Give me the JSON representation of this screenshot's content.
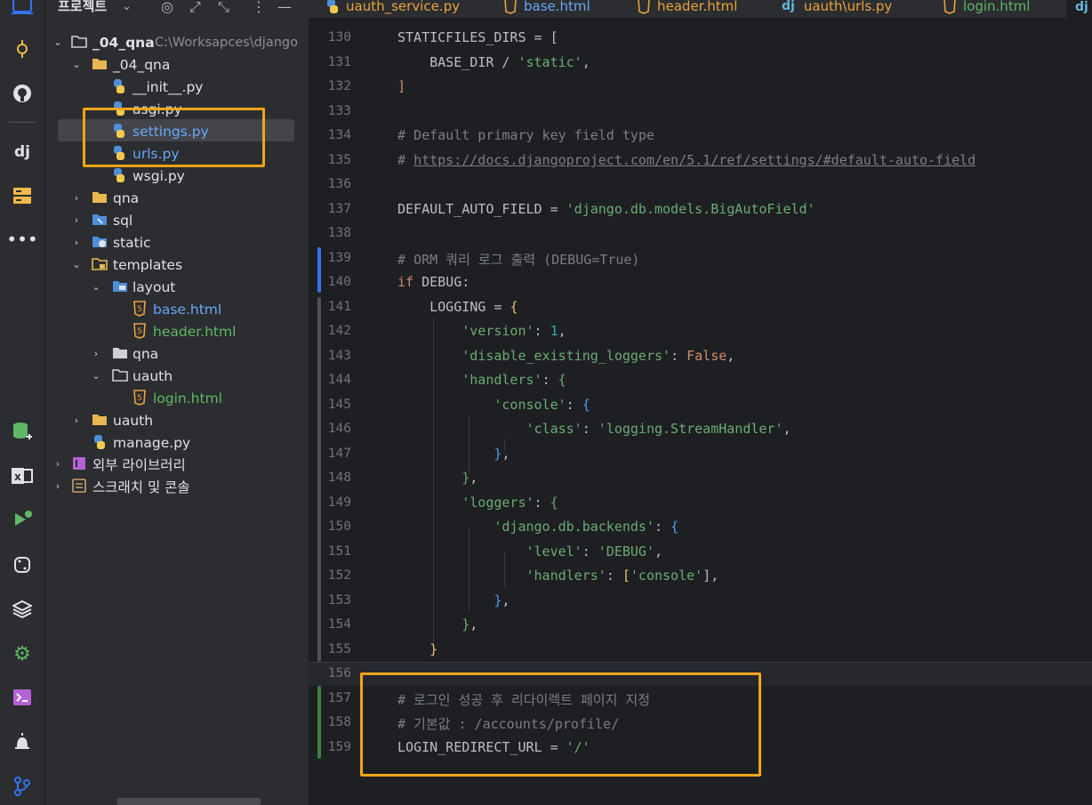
{
  "project_panel": {
    "title": "프로젝트",
    "tree": [
      {
        "label": "_04_qna",
        "path": "C:\\Worksapces\\django"
      },
      {
        "label": "_04_qna"
      },
      {
        "label": "__init__.py"
      },
      {
        "label": "asgi.py"
      },
      {
        "label": "settings.py"
      },
      {
        "label": "urls.py"
      },
      {
        "label": "wsgi.py"
      },
      {
        "label": "qna"
      },
      {
        "label": "sql"
      },
      {
        "label": "static"
      },
      {
        "label": "templates"
      },
      {
        "label": "layout"
      },
      {
        "label": "base.html"
      },
      {
        "label": "header.html"
      },
      {
        "label": "qna"
      },
      {
        "label": "uauth"
      },
      {
        "label": "login.html"
      },
      {
        "label": "uauth"
      },
      {
        "label": "manage.py"
      },
      {
        "label": "외부 라이브러리"
      },
      {
        "label": "스크래치 및 콘솔"
      }
    ]
  },
  "tabs": [
    {
      "label": "uauth_service.py",
      "icon": "python-icon"
    },
    {
      "label": "base.html",
      "icon": "html-icon"
    },
    {
      "label": "header.html",
      "icon": "html-icon"
    },
    {
      "label": "uauth\\urls.py",
      "icon": "django-icon"
    },
    {
      "label": "login.html",
      "icon": "html-icon"
    },
    {
      "label": "dj",
      "icon": "django-icon"
    }
  ],
  "editor": {
    "line_numbers": [
      "130",
      "131",
      "132",
      "133",
      "134",
      "135",
      "136",
      "137",
      "138",
      "139",
      "140",
      "141",
      "142",
      "143",
      "144",
      "145",
      "146",
      "147",
      "148",
      "149",
      "150",
      "151",
      "152",
      "153",
      "154",
      "155",
      "156",
      "157",
      "158",
      "159"
    ],
    "code": {
      "l130a": "STATICFILES_DIRS = [",
      "l131a": "    BASE_DIR / ",
      "l131b": "'static'",
      "l131c": ",",
      "l132a": "]",
      "l134a": "# Default primary key field type",
      "l135a": "# ",
      "l135b": "https://docs.djangoproject.com/en/5.1/ref/settings/#default-auto-field",
      "l137a": "DEFAULT_AUTO_FIELD = ",
      "l137b": "'django.db.models.BigAutoField'",
      "l139a": "# ORM 쿼리 로그 출력 (DEBUG=True)",
      "l140a": "if",
      "l140b": " DEBUG:",
      "l141a": "    LOGGING = ",
      "l141b": "{",
      "l142a": "        ",
      "l142b": "'version'",
      "l142c": ": ",
      "l142d": "1",
      "l142e": ",",
      "l143a": "        ",
      "l143b": "'disable_existing_loggers'",
      "l143c": ": ",
      "l143d": "False",
      "l143e": ",",
      "l144a": "        ",
      "l144b": "'handlers'",
      "l144c": ": ",
      "l144d": "{",
      "l145a": "            ",
      "l145b": "'console'",
      "l145c": ": ",
      "l145d": "{",
      "l146a": "                ",
      "l146b": "'class'",
      "l146c": ": ",
      "l146d": "'logging.StreamHandler'",
      "l146e": ",",
      "l147a": "            ",
      "l147b": "}",
      "l147c": ",",
      "l148a": "        ",
      "l148b": "}",
      "l148c": ",",
      "l149a": "        ",
      "l149b": "'loggers'",
      "l149c": ": ",
      "l149d": "{",
      "l150a": "            ",
      "l150b": "'django.db.backends'",
      "l150c": ": ",
      "l150d": "{",
      "l151a": "                ",
      "l151b": "'level'",
      "l151c": ": ",
      "l151d": "'DEBUG'",
      "l151e": ",",
      "l152a": "                ",
      "l152b": "'handlers'",
      "l152c": ": ",
      "l152d": "[",
      "l152e": "'console'",
      "l152f": "],",
      "l153a": "            ",
      "l153b": "}",
      "l153c": ",",
      "l154a": "        ",
      "l154b": "}",
      "l154c": ",",
      "l155a": "    ",
      "l155b": "}",
      "l157a": "# 로그인 성공 후 리다이렉트 페이지 지정",
      "l158a": "# 기본값 : /accounts/profile/",
      "l159a": "LOGIN_REDIRECT_URL = ",
      "l159b": "'/'"
    }
  },
  "colors": {
    "highlight_box": "#f5a418",
    "keyword": "#cf8e6d",
    "string": "#6aab73",
    "comment": "#7a7e85",
    "number": "#2aacb8"
  }
}
